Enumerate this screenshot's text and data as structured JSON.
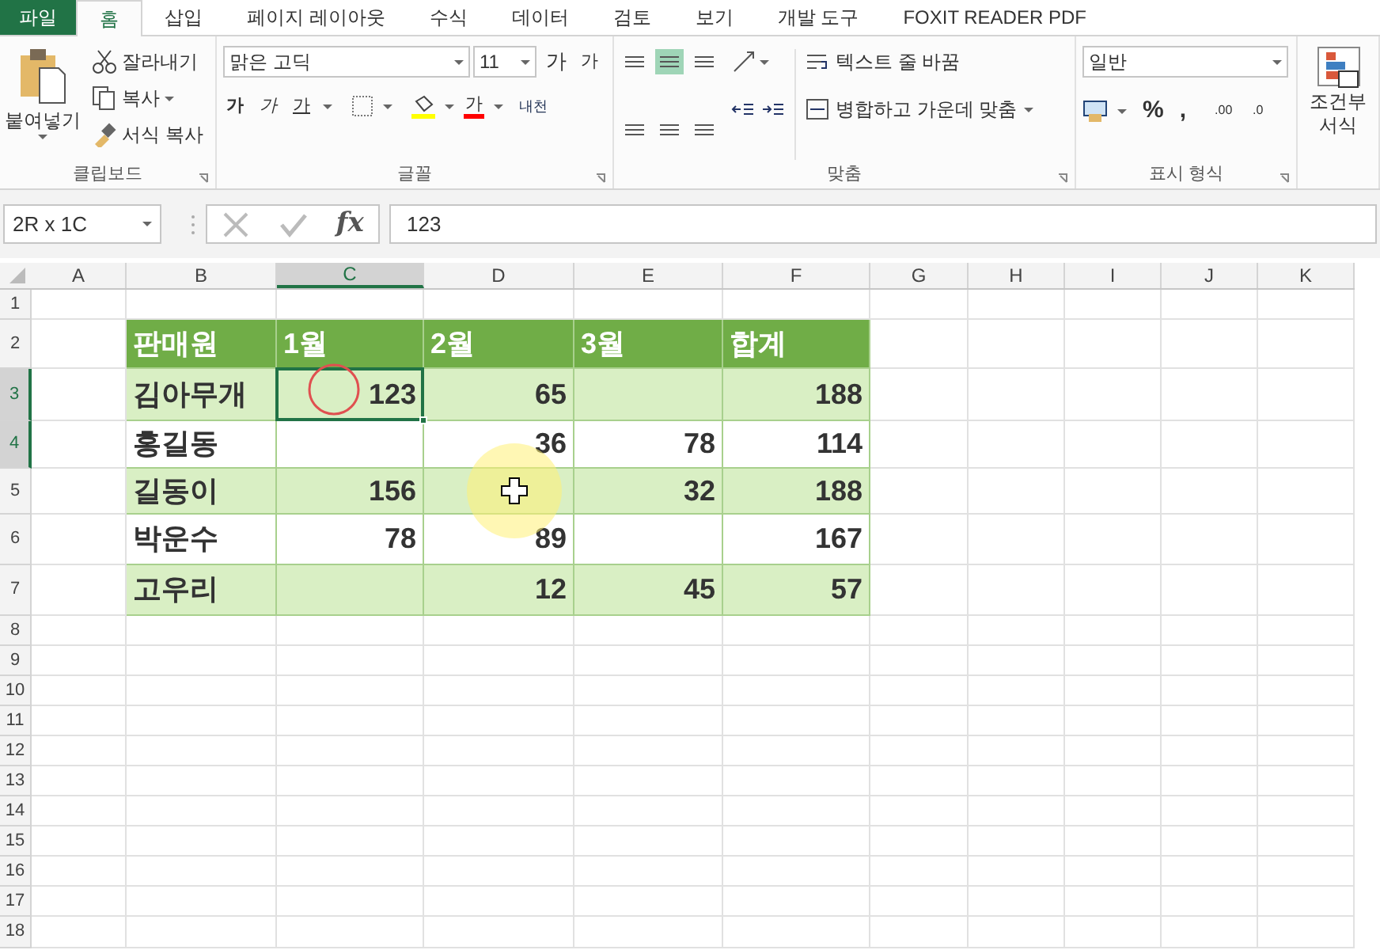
{
  "tabs": [
    {
      "label": "파일",
      "kind": "file",
      "selected": false
    },
    {
      "label": "홈",
      "kind": "tab",
      "selected": true
    },
    {
      "label": "삽입",
      "kind": "tab",
      "selected": false
    },
    {
      "label": "페이지 레이아웃",
      "kind": "tab",
      "selected": false
    },
    {
      "label": "수식",
      "kind": "tab",
      "selected": false
    },
    {
      "label": "데이터",
      "kind": "tab",
      "selected": false
    },
    {
      "label": "검토",
      "kind": "tab",
      "selected": false
    },
    {
      "label": "보기",
      "kind": "tab",
      "selected": false
    },
    {
      "label": "개발 도구",
      "kind": "tab",
      "selected": false
    },
    {
      "label": "FOXIT READER PDF",
      "kind": "tab",
      "selected": false
    }
  ],
  "ribbon": {
    "clipboard": {
      "paste": "붙여넣기",
      "cut": "잘라내기",
      "copy": "복사",
      "format_painter": "서식 복사",
      "name": "클립보드"
    },
    "font": {
      "font_name": "맑은 고딕",
      "font_size": "11",
      "grow": "가",
      "shrink": "가",
      "bold": "가",
      "italic": "가",
      "underline": "가",
      "font_color": "가",
      "phonetic": "내천",
      "name": "글꼴"
    },
    "alignment": {
      "middle_align_selected": true,
      "wrap_text": "텍스트 줄 바꿈",
      "merge_center": "병합하고 가운데 맞춤",
      "name": "맞춤"
    },
    "number": {
      "format": "일반",
      "percent": "%",
      "comma": ",",
      "decrease_decimal": ".00",
      "increase_decimal": ".0",
      "name": "표시 형식"
    },
    "styles": {
      "conditional_formatting": "조건부 서식"
    }
  },
  "formula_bar": {
    "name_box": "2R x 1C",
    "function_label": "fx",
    "formula": "123"
  },
  "sheet": {
    "columns": [
      {
        "label": "A",
        "selected": false
      },
      {
        "label": "B",
        "selected": false
      },
      {
        "label": "C",
        "selected": true
      },
      {
        "label": "D",
        "selected": false
      },
      {
        "label": "E",
        "selected": false
      },
      {
        "label": "F",
        "selected": false
      },
      {
        "label": "G",
        "selected": false
      },
      {
        "label": "H",
        "selected": false
      },
      {
        "label": "I",
        "selected": false
      },
      {
        "label": "J",
        "selected": false
      },
      {
        "label": "K",
        "selected": false
      }
    ],
    "rows": [
      {
        "label": "1",
        "selected": false
      },
      {
        "label": "2",
        "selected": false
      },
      {
        "label": "3",
        "selected": true
      },
      {
        "label": "4",
        "selected": true
      },
      {
        "label": "5",
        "selected": false
      },
      {
        "label": "6",
        "selected": false
      },
      {
        "label": "7",
        "selected": false
      },
      {
        "label": "8",
        "selected": false
      },
      {
        "label": "9",
        "selected": false
      },
      {
        "label": "10",
        "selected": false
      },
      {
        "label": "11",
        "selected": false
      },
      {
        "label": "12",
        "selected": false
      },
      {
        "label": "13",
        "selected": false
      },
      {
        "label": "14",
        "selected": false
      },
      {
        "label": "15",
        "selected": false
      },
      {
        "label": "16",
        "selected": false
      },
      {
        "label": "17",
        "selected": false
      },
      {
        "label": "18",
        "selected": false
      }
    ],
    "table": {
      "header": [
        "판매원",
        "1월",
        "2월",
        "3월",
        "합계"
      ],
      "rows": [
        {
          "shaded": true,
          "cells": [
            "김아무개",
            "123",
            "65",
            null,
            "188"
          ]
        },
        {
          "shaded": false,
          "cells": [
            "홍길동",
            null,
            "36",
            "78",
            "114"
          ]
        },
        {
          "shaded": true,
          "cells": [
            "길동이",
            "156",
            null,
            "32",
            "188"
          ]
        },
        {
          "shaded": false,
          "cells": [
            "박운수",
            "78",
            "89",
            null,
            "167"
          ]
        },
        {
          "shaded": true,
          "cells": [
            "고우리",
            null,
            "12",
            "45",
            "57"
          ]
        }
      ]
    }
  }
}
